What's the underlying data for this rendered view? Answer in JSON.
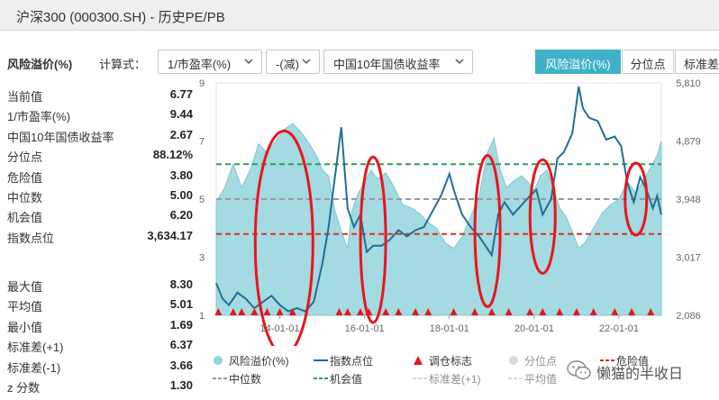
{
  "window": {
    "title": "沪深300 (000300.SH) - 历史PE/PB"
  },
  "controls": {
    "section_label": "风险溢价(%)",
    "formula_label": "计算式：",
    "select1": "1/市盈率(%)",
    "select2": "-(减)",
    "select3": "中国10年国债收益率",
    "tabs": [
      "风险溢价(%)",
      "分位点",
      "标准差"
    ],
    "active_tab": 0
  },
  "stats_top": [
    {
      "k": "当前值",
      "v": "6.77"
    },
    {
      "k": "1/市盈率(%)",
      "v": "9.44"
    },
    {
      "k": "中国10年国债收益率",
      "v": "2.67"
    },
    {
      "k": "分位点",
      "v": "88.12%"
    },
    {
      "k": "危险值",
      "v": "3.80"
    },
    {
      "k": "中位数",
      "v": "5.00"
    },
    {
      "k": "机会值",
      "v": "6.20"
    },
    {
      "k": "指数点位",
      "v": "3,634.17"
    }
  ],
  "stats_bottom": [
    {
      "k": "最大值",
      "v": "8.30"
    },
    {
      "k": "平均值",
      "v": "5.01"
    },
    {
      "k": "最小值",
      "v": "1.69"
    },
    {
      "k": "标准差(+1)",
      "v": "6.37"
    },
    {
      "k": "标准差(-1)",
      "v": "3.66"
    },
    {
      "k": "z 分数",
      "v": "1.30"
    }
  ],
  "legend": {
    "row1": [
      "风险溢价(%)",
      "指数点位",
      "调仓标志",
      "分位点",
      "危险值"
    ],
    "row2": [
      "中位数",
      "机会值",
      "标准差(+1)",
      "平均值"
    ]
  },
  "watermark": "懒猫的半收日",
  "colors": {
    "area": "#94d4dc",
    "index_line": "#1f6f94",
    "danger": "#d9302b",
    "median": "#999999",
    "opportunity": "#2e9e5a",
    "accent": "#3fb1c8",
    "marker": "#e8151b",
    "ellipse": "#e8151b"
  },
  "chart_data": {
    "type": "area",
    "x_ticks": [
      "14-01-01",
      "16-01-01",
      "18-01-01",
      "20-01-01",
      "22-01-01"
    ],
    "y_left_ticks": [
      "1",
      "3",
      "5",
      "7",
      "9"
    ],
    "y_right_ticks": [
      "2,086",
      "3,017",
      "3,948",
      "4,879",
      "5,810"
    ],
    "ylim_left": [
      1,
      9
    ],
    "ylim_right": [
      2086,
      5810
    ],
    "x_start_year": 2012.5,
    "x_end_year": 2023.0,
    "reference_lines": {
      "opportunity": 6.2,
      "median": 5.0,
      "danger": 3.8
    },
    "series": [
      {
        "name": "风险溢价(%)",
        "axis": "left",
        "points": [
          [
            2012.5,
            4.9
          ],
          [
            2012.7,
            5.4
          ],
          [
            2012.9,
            6.2
          ],
          [
            2013.1,
            5.4
          ],
          [
            2013.3,
            6.0
          ],
          [
            2013.5,
            6.9
          ],
          [
            2013.7,
            6.6
          ],
          [
            2013.9,
            7.0
          ],
          [
            2014.1,
            7.4
          ],
          [
            2014.3,
            7.6
          ],
          [
            2014.5,
            7.3
          ],
          [
            2014.7,
            6.9
          ],
          [
            2014.9,
            6.4
          ],
          [
            2015.0,
            6.0
          ],
          [
            2015.15,
            5.8
          ],
          [
            2015.3,
            4.6
          ],
          [
            2015.45,
            3.9
          ],
          [
            2015.6,
            3.3
          ],
          [
            2015.7,
            4.6
          ],
          [
            2015.85,
            5.2
          ],
          [
            2016.0,
            5.6
          ],
          [
            2016.15,
            6.0
          ],
          [
            2016.3,
            5.7
          ],
          [
            2016.5,
            5.9
          ],
          [
            2016.7,
            5.4
          ],
          [
            2016.9,
            4.8
          ],
          [
            2017.1,
            4.7
          ],
          [
            2017.3,
            4.5
          ],
          [
            2017.5,
            4.2
          ],
          [
            2017.7,
            4.0
          ],
          [
            2017.9,
            3.5
          ],
          [
            2018.1,
            3.3
          ],
          [
            2018.3,
            3.7
          ],
          [
            2018.5,
            4.4
          ],
          [
            2018.7,
            5.1
          ],
          [
            2018.9,
            6.6
          ],
          [
            2019.05,
            7.1
          ],
          [
            2019.2,
            6.0
          ],
          [
            2019.35,
            5.4
          ],
          [
            2019.5,
            5.6
          ],
          [
            2019.7,
            5.8
          ],
          [
            2019.85,
            5.6
          ],
          [
            2020.0,
            5.3
          ],
          [
            2020.15,
            5.8
          ],
          [
            2020.3,
            6.0
          ],
          [
            2020.45,
            5.4
          ],
          [
            2020.6,
            4.7
          ],
          [
            2020.75,
            4.4
          ],
          [
            2020.9,
            3.9
          ],
          [
            2021.05,
            3.3
          ],
          [
            2021.2,
            3.5
          ],
          [
            2021.4,
            4.0
          ],
          [
            2021.6,
            4.5
          ],
          [
            2021.8,
            4.8
          ],
          [
            2022.0,
            5.0
          ],
          [
            2022.2,
            5.6
          ],
          [
            2022.4,
            5.2
          ],
          [
            2022.6,
            5.7
          ],
          [
            2022.75,
            6.1
          ],
          [
            2022.9,
            6.5
          ],
          [
            2023.0,
            7.0
          ]
        ]
      },
      {
        "name": "指数点位",
        "axis": "right",
        "points": [
          [
            2012.5,
            2600
          ],
          [
            2012.65,
            2350
          ],
          [
            2012.8,
            2250
          ],
          [
            2013.0,
            2450
          ],
          [
            2013.2,
            2350
          ],
          [
            2013.4,
            2200
          ],
          [
            2013.6,
            2300
          ],
          [
            2013.8,
            2400
          ],
          [
            2014.0,
            2250
          ],
          [
            2014.2,
            2150
          ],
          [
            2014.4,
            2200
          ],
          [
            2014.6,
            2150
          ],
          [
            2014.8,
            2300
          ],
          [
            2015.0,
            2900
          ],
          [
            2015.15,
            3500
          ],
          [
            2015.3,
            4300
          ],
          [
            2015.45,
            5100
          ],
          [
            2015.6,
            3800
          ],
          [
            2015.75,
            3500
          ],
          [
            2015.9,
            3700
          ],
          [
            2016.05,
            3100
          ],
          [
            2016.2,
            3200
          ],
          [
            2016.4,
            3200
          ],
          [
            2016.6,
            3300
          ],
          [
            2016.8,
            3450
          ],
          [
            2017.0,
            3350
          ],
          [
            2017.2,
            3450
          ],
          [
            2017.4,
            3500
          ],
          [
            2017.6,
            3750
          ],
          [
            2017.8,
            4000
          ],
          [
            2018.0,
            4350
          ],
          [
            2018.1,
            4100
          ],
          [
            2018.3,
            3700
          ],
          [
            2018.5,
            3500
          ],
          [
            2018.7,
            3350
          ],
          [
            2018.85,
            3200
          ],
          [
            2019.0,
            3050
          ],
          [
            2019.15,
            3700
          ],
          [
            2019.3,
            3900
          ],
          [
            2019.5,
            3700
          ],
          [
            2019.7,
            3850
          ],
          [
            2019.9,
            4000
          ],
          [
            2020.05,
            4100
          ],
          [
            2020.2,
            3700
          ],
          [
            2020.4,
            3950
          ],
          [
            2020.55,
            4600
          ],
          [
            2020.7,
            4700
          ],
          [
            2020.9,
            5000
          ],
          [
            2021.05,
            5750
          ],
          [
            2021.15,
            5400
          ],
          [
            2021.3,
            5250
          ],
          [
            2021.5,
            5200
          ],
          [
            2021.7,
            4900
          ],
          [
            2021.9,
            4950
          ],
          [
            2022.05,
            4800
          ],
          [
            2022.2,
            4200
          ],
          [
            2022.35,
            3900
          ],
          [
            2022.5,
            4300
          ],
          [
            2022.65,
            4100
          ],
          [
            2022.8,
            3800
          ],
          [
            2022.9,
            4000
          ],
          [
            2023.0,
            3700
          ]
        ]
      }
    ],
    "rebalance_markers": [
      2012.55,
      2012.9,
      2013.1,
      2013.4,
      2013.7,
      2014.0,
      2014.3,
      2015.4,
      2015.6,
      2015.9,
      2016.1,
      2016.5,
      2016.8,
      2017.2,
      2017.5,
      2018.1,
      2018.6,
      2019.0,
      2019.4,
      2019.9,
      2020.2,
      2020.6,
      2021.0,
      2021.4,
      2021.9,
      2022.3,
      2022.75
    ]
  }
}
